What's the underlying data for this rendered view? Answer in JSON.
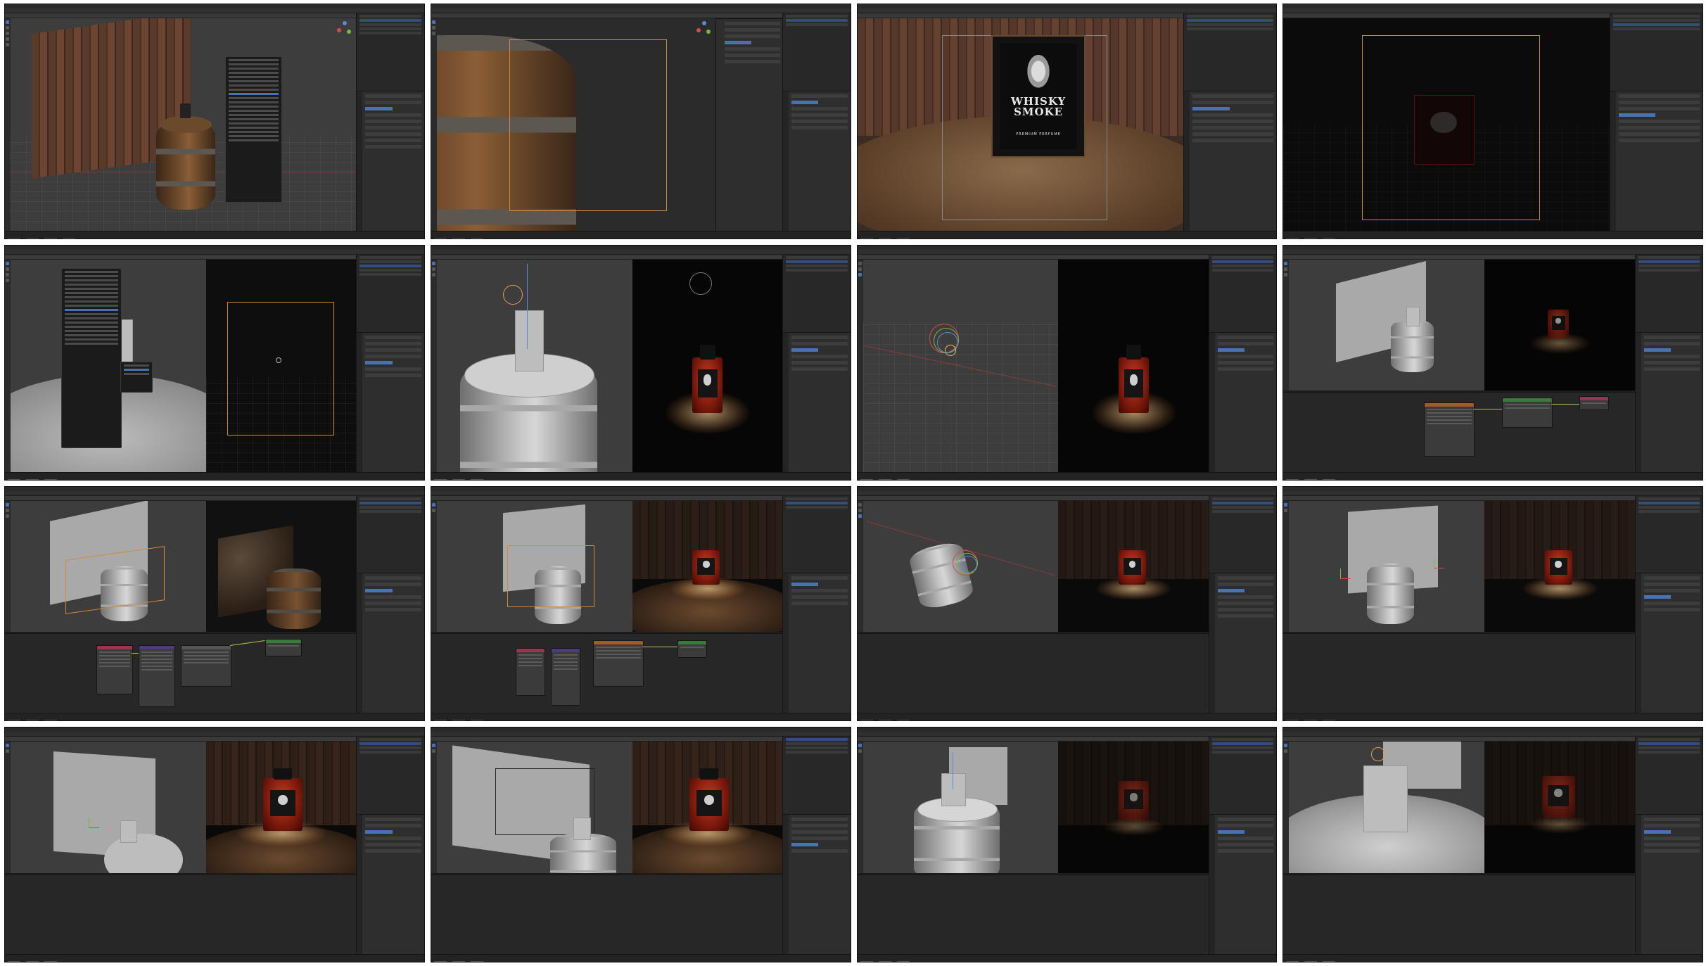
{
  "page": {
    "layout": "4x4 thumbnail contact sheet of Blender sessions"
  },
  "tiles": [
    {
      "id": 1,
      "title": "",
      "scene": "wood wall, barrel with small bottle, Add menu open"
    },
    {
      "id": 2,
      "title": "",
      "scene": "camera view close-up of wooden barrel"
    },
    {
      "id": 3,
      "title": "",
      "scene": "rendered poster on barrel"
    },
    {
      "id": 4,
      "title": "",
      "scene": "dark render with poster"
    },
    {
      "id": 5,
      "title": "",
      "scene": "barrel clay view with add menu, split render"
    },
    {
      "id": 6,
      "title": "",
      "scene": "spot light above barrel, red bottle render"
    },
    {
      "id": 7,
      "title": "",
      "scene": "rotating light gizmo, red bottle render"
    },
    {
      "id": 8,
      "title": "",
      "scene": "plane backdrop, node editor"
    },
    {
      "id": 9,
      "title": "",
      "scene": "textured backdrop render, node editor"
    },
    {
      "id": 10,
      "title": "",
      "scene": "backdrop, node editor with image texture"
    },
    {
      "id": 11,
      "title": "",
      "scene": "rotate gizmo on barrel"
    },
    {
      "id": 12,
      "title": "",
      "scene": "backdrop with empties"
    },
    {
      "id": 13,
      "title": "",
      "scene": "backdrop close-up, lit red bottle render"
    },
    {
      "id": 14,
      "title": "",
      "scene": "angled backdrop, red bottle render"
    },
    {
      "id": 15,
      "title": "",
      "scene": "barrel with bottle, dark render"
    },
    {
      "id": 16,
      "title": "",
      "scene": "top down barrel, bottle render"
    }
  ],
  "poster": {
    "line1": "WHISKY",
    "line2": "SMOKE",
    "tagline": "PREMIUM PERFUME"
  },
  "colors": {
    "ui_bg": "#1d1d1d",
    "panel": "#2e2e2e",
    "selection_blue": "#4772b3",
    "camera_frame": "#d08a3a",
    "x_axis": "#8a3b3b",
    "y_axis": "#6b8a2a",
    "node_red": "#9b3450",
    "node_purple": "#4d3b82",
    "node_orange": "#a35a2a",
    "node_green": "#3a7a3a"
  },
  "icons": [
    "navigation-gizmo-icon",
    "tool-icon",
    "camera-icon",
    "light-icon"
  ]
}
